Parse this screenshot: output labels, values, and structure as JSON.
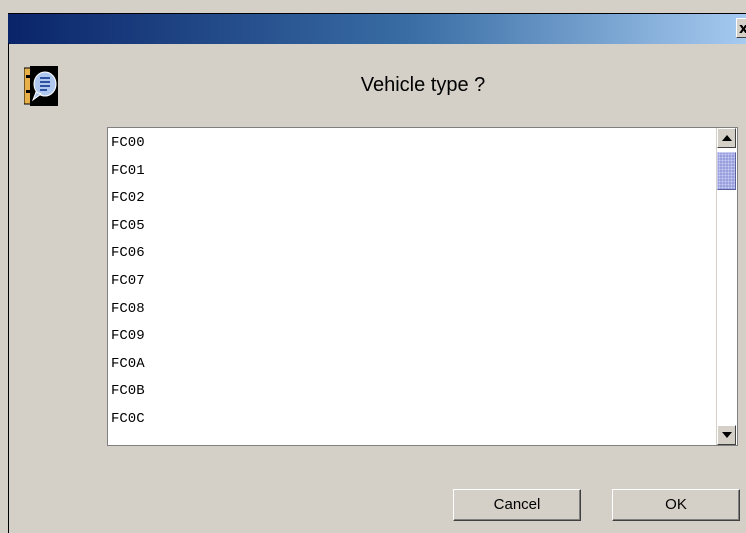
{
  "window": {
    "close_glyph": "x"
  },
  "dialog": {
    "question": "Vehicle type ?"
  },
  "list": {
    "items": [
      "FC00",
      "FC01",
      "FC02",
      "FC05",
      "FC06",
      "FC07",
      "FC08",
      "FC09",
      "FC0A",
      "FC0B",
      "FC0C"
    ]
  },
  "buttons": {
    "cancel": "Cancel",
    "ok": "OK"
  },
  "icons": {
    "dialog_icon": "message-info-icon"
  }
}
